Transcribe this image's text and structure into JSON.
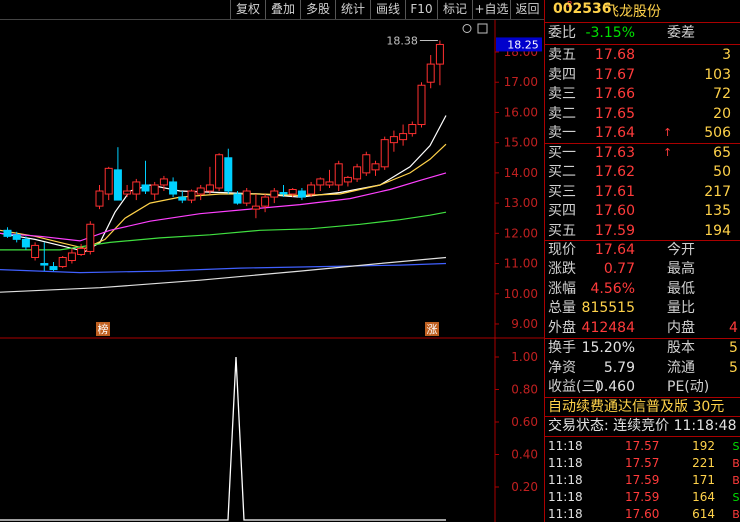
{
  "toolbar": {
    "buttons": [
      "复权",
      "叠加",
      "多股",
      "统计",
      "画线",
      "F10",
      "标记",
      "+自选",
      "返回"
    ]
  },
  "chart": {
    "main_axis_labels": [
      "18.00",
      "17.00",
      "16.00",
      "15.00",
      "14.00",
      "13.00",
      "12.00",
      "11.00",
      "10.00",
      "9.00"
    ],
    "current_price_tag": "18.25",
    "high_annotation": "18.38",
    "event_markers": [
      "榜",
      "涨"
    ],
    "sub_axis_labels": [
      "1.00",
      "0.80",
      "0.60",
      "0.40",
      "0.20"
    ]
  },
  "quote": {
    "r_badge": "R",
    "code": "002536",
    "name": "飞龙股份",
    "ratio": {
      "label": "委比",
      "value": "-3.15%",
      "label2": "委差"
    },
    "sell": [
      {
        "label": "卖五",
        "price": "17.68",
        "vol": "3"
      },
      {
        "label": "卖四",
        "price": "17.67",
        "vol": "103"
      },
      {
        "label": "卖三",
        "price": "17.66",
        "vol": "72"
      },
      {
        "label": "卖二",
        "price": "17.65",
        "vol": "20"
      },
      {
        "label": "卖一",
        "price": "17.64",
        "vol": "506",
        "arrow": "↑"
      }
    ],
    "buy": [
      {
        "label": "买一",
        "price": "17.63",
        "vol": "65",
        "arrow": "↑"
      },
      {
        "label": "买二",
        "price": "17.62",
        "vol": "50"
      },
      {
        "label": "买三",
        "price": "17.61",
        "vol": "217"
      },
      {
        "label": "买四",
        "price": "17.60",
        "vol": "135"
      },
      {
        "label": "买五",
        "price": "17.59",
        "vol": "194"
      }
    ],
    "stats1": [
      {
        "l1": "现价",
        "v1": "17.64",
        "l2": "今开",
        "v2": "",
        "c1": "up"
      },
      {
        "l1": "涨跌",
        "v1": "0.77",
        "l2": "最高",
        "v2": "",
        "c1": "up"
      },
      {
        "l1": "涨幅",
        "v1": "4.56%",
        "l2": "最低",
        "v2": "",
        "c1": "up"
      },
      {
        "l1": "总量",
        "v1": "815515",
        "l2": "量比",
        "v2": "",
        "c1": "yel"
      },
      {
        "l1": "外盘",
        "v1": "412484",
        "l2": "内盘",
        "v2": "4",
        "c1": "up"
      }
    ],
    "stats2": [
      {
        "l1": "换手",
        "v1": "15.20%",
        "l2": "股本",
        "v2": "5"
      },
      {
        "l1": "净资",
        "v1": "5.79",
        "l2": "流通",
        "v2": "5"
      },
      {
        "l1": "收益(三)",
        "v1": "0.460",
        "l2": "PE(动)",
        "v2": ""
      }
    ],
    "ad_text": "自动续费通达信普及版 30元",
    "status_text": "交易状态: 连续竞价 11:18:48",
    "ticks": [
      {
        "time": "11:18",
        "price": "17.57",
        "vol": "192",
        "side": "S",
        "color": "down"
      },
      {
        "time": "11:18",
        "price": "17.57",
        "vol": "221",
        "side": "B",
        "color": "up"
      },
      {
        "time": "11:18",
        "price": "17.59",
        "vol": "171",
        "side": "B",
        "color": "up"
      },
      {
        "time": "11:18",
        "price": "17.59",
        "vol": "164",
        "side": "S",
        "color": "down"
      },
      {
        "time": "11:18",
        "price": "17.60",
        "vol": "614",
        "side": "B",
        "color": "up"
      }
    ]
  },
  "candles": [
    [
      12.1,
      12.2,
      11.85,
      11.9
    ],
    [
      11.95,
      12.05,
      11.7,
      11.8
    ],
    [
      11.8,
      11.9,
      11.45,
      11.55
    ],
    [
      11.2,
      11.7,
      11.1,
      11.6
    ],
    [
      11.0,
      11.7,
      10.75,
      10.95
    ],
    [
      10.9,
      11.05,
      10.75,
      10.8
    ],
    [
      10.9,
      11.25,
      10.85,
      11.2
    ],
    [
      11.1,
      11.5,
      11.0,
      11.35
    ],
    [
      11.3,
      11.65,
      11.25,
      11.5
    ],
    [
      11.4,
      12.4,
      11.3,
      12.3
    ],
    [
      12.9,
      13.6,
      12.8,
      13.4
    ],
    [
      13.3,
      14.2,
      13.1,
      14.15
    ],
    [
      14.1,
      14.85,
      13.8,
      13.1
    ],
    [
      13.3,
      13.6,
      13.2,
      13.4
    ],
    [
      13.3,
      13.8,
      13.1,
      13.7
    ],
    [
      13.6,
      14.4,
      13.3,
      13.4
    ],
    [
      13.3,
      13.7,
      13.1,
      13.6
    ],
    [
      13.6,
      13.9,
      13.4,
      13.8
    ],
    [
      13.7,
      13.85,
      13.2,
      13.3
    ],
    [
      13.2,
      13.4,
      13.0,
      13.1
    ],
    [
      13.1,
      13.45,
      13.0,
      13.4
    ],
    [
      13.3,
      13.6,
      13.1,
      13.5
    ],
    [
      13.4,
      14.2,
      13.3,
      13.6
    ],
    [
      13.5,
      14.65,
      13.4,
      14.6
    ],
    [
      14.5,
      14.8,
      13.3,
      13.4
    ],
    [
      13.3,
      13.4,
      12.95,
      13.0
    ],
    [
      13.0,
      13.5,
      12.9,
      13.4
    ],
    [
      12.8,
      13.3,
      12.5,
      12.9
    ],
    [
      12.9,
      13.3,
      12.7,
      13.2
    ],
    [
      13.2,
      13.5,
      13.0,
      13.4
    ],
    [
      13.35,
      13.6,
      13.2,
      13.3
    ],
    [
      13.3,
      13.5,
      13.2,
      13.45
    ],
    [
      13.4,
      13.5,
      13.1,
      13.2
    ],
    [
      13.3,
      13.7,
      13.2,
      13.6
    ],
    [
      13.6,
      13.85,
      13.4,
      13.8
    ],
    [
      13.6,
      14.1,
      13.5,
      13.7
    ],
    [
      13.6,
      14.4,
      13.4,
      14.3
    ],
    [
      13.7,
      13.9,
      13.55,
      13.85
    ],
    [
      13.8,
      14.3,
      13.7,
      14.2
    ],
    [
      14.0,
      14.7,
      13.9,
      14.6
    ],
    [
      14.1,
      14.4,
      13.9,
      14.3
    ],
    [
      14.2,
      15.2,
      14.1,
      15.1
    ],
    [
      15.0,
      15.4,
      14.7,
      15.2
    ],
    [
      15.1,
      15.6,
      14.9,
      15.3
    ],
    [
      15.3,
      15.7,
      15.2,
      15.6
    ],
    [
      15.6,
      17.0,
      15.5,
      16.9
    ],
    [
      17.0,
      17.9,
      16.8,
      17.6
    ],
    [
      17.6,
      18.38,
      16.9,
      18.25
    ]
  ],
  "ma_lines": [
    {
      "color": "#ffffff",
      "points": [
        [
          0,
          12.0
        ],
        [
          35,
          11.8
        ],
        [
          60,
          11.6
        ],
        [
          85,
          11.4
        ],
        [
          100,
          11.7
        ],
        [
          115,
          12.7
        ],
        [
          130,
          13.4
        ],
        [
          150,
          13.6
        ],
        [
          180,
          13.4
        ],
        [
          220,
          13.35
        ],
        [
          260,
          13.3
        ],
        [
          300,
          13.2
        ],
        [
          340,
          13.35
        ],
        [
          380,
          13.6
        ],
        [
          410,
          14.2
        ],
        [
          430,
          14.9
        ],
        [
          446,
          15.9
        ]
      ]
    },
    {
      "color": "#ffd24a",
      "points": [
        [
          0,
          12.1
        ],
        [
          35,
          11.9
        ],
        [
          60,
          11.7
        ],
        [
          85,
          11.5
        ],
        [
          105,
          11.8
        ],
        [
          125,
          12.5
        ],
        [
          150,
          13.0
        ],
        [
          180,
          13.2
        ],
        [
          220,
          13.3
        ],
        [
          260,
          13.3
        ],
        [
          300,
          13.25
        ],
        [
          340,
          13.3
        ],
        [
          380,
          13.6
        ],
        [
          410,
          14.0
        ],
        [
          430,
          14.45
        ],
        [
          446,
          14.95
        ]
      ]
    },
    {
      "color": "#ff40ff",
      "points": [
        [
          0,
          12.0
        ],
        [
          40,
          11.9
        ],
        [
          80,
          11.75
        ],
        [
          110,
          12.1
        ],
        [
          150,
          12.4
        ],
        [
          200,
          12.65
        ],
        [
          250,
          12.8
        ],
        [
          300,
          12.95
        ],
        [
          350,
          13.15
        ],
        [
          390,
          13.45
        ],
        [
          420,
          13.75
        ],
        [
          446,
          14.0
        ]
      ]
    },
    {
      "color": "#40e040",
      "points": [
        [
          0,
          11.45
        ],
        [
          60,
          11.45
        ],
        [
          110,
          11.7
        ],
        [
          160,
          11.85
        ],
        [
          210,
          11.95
        ],
        [
          260,
          12.1
        ],
        [
          310,
          12.15
        ],
        [
          360,
          12.3
        ],
        [
          400,
          12.45
        ],
        [
          430,
          12.6
        ],
        [
          446,
          12.7
        ]
      ]
    },
    {
      "color": "#4060ff",
      "points": [
        [
          0,
          10.8
        ],
        [
          80,
          10.7
        ],
        [
          160,
          10.75
        ],
        [
          240,
          10.85
        ],
        [
          320,
          10.9
        ],
        [
          400,
          10.95
        ],
        [
          446,
          11.0
        ]
      ]
    },
    {
      "color": "#e0e0e0",
      "points": [
        [
          0,
          10.05
        ],
        [
          100,
          10.2
        ],
        [
          200,
          10.45
        ],
        [
          300,
          10.75
        ],
        [
          380,
          11.0
        ],
        [
          446,
          11.2
        ]
      ]
    }
  ],
  "sub_line": [
    [
      0,
      0
    ],
    [
      228,
      0
    ],
    [
      236,
      1.0
    ],
    [
      244,
      0
    ],
    [
      446,
      0
    ]
  ]
}
